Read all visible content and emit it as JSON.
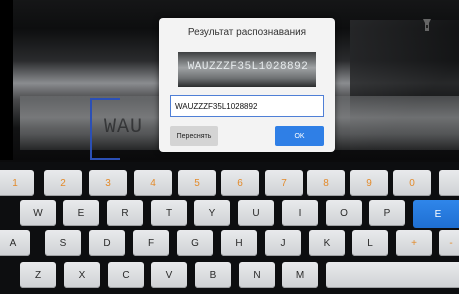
{
  "dialog": {
    "title": "Результат распознавания",
    "preview_text": "WAUZZZF35L1028892",
    "input_value": "WAUZZZF35L1028892",
    "rescan_label": "Переснять",
    "ok_label": "OK"
  },
  "camera": {
    "vin_fragment": "WAU"
  },
  "keyboard": {
    "numbers": [
      "1",
      "2",
      "3",
      "4",
      "5",
      "6",
      "7",
      "8",
      "9",
      "0"
    ],
    "row1": [
      "W",
      "E",
      "R",
      "T",
      "Y",
      "U",
      "I",
      "O",
      "P"
    ],
    "row2": [
      "A",
      "S",
      "D",
      "F",
      "G",
      "H",
      "J",
      "K",
      "L",
      "+",
      "-"
    ],
    "row3": [
      "Z",
      "X",
      "C",
      "V",
      "B",
      "N",
      "M"
    ],
    "enter_label": "E",
    "accent_color": "#2f7fe6",
    "number_color": "#e38a2a"
  }
}
